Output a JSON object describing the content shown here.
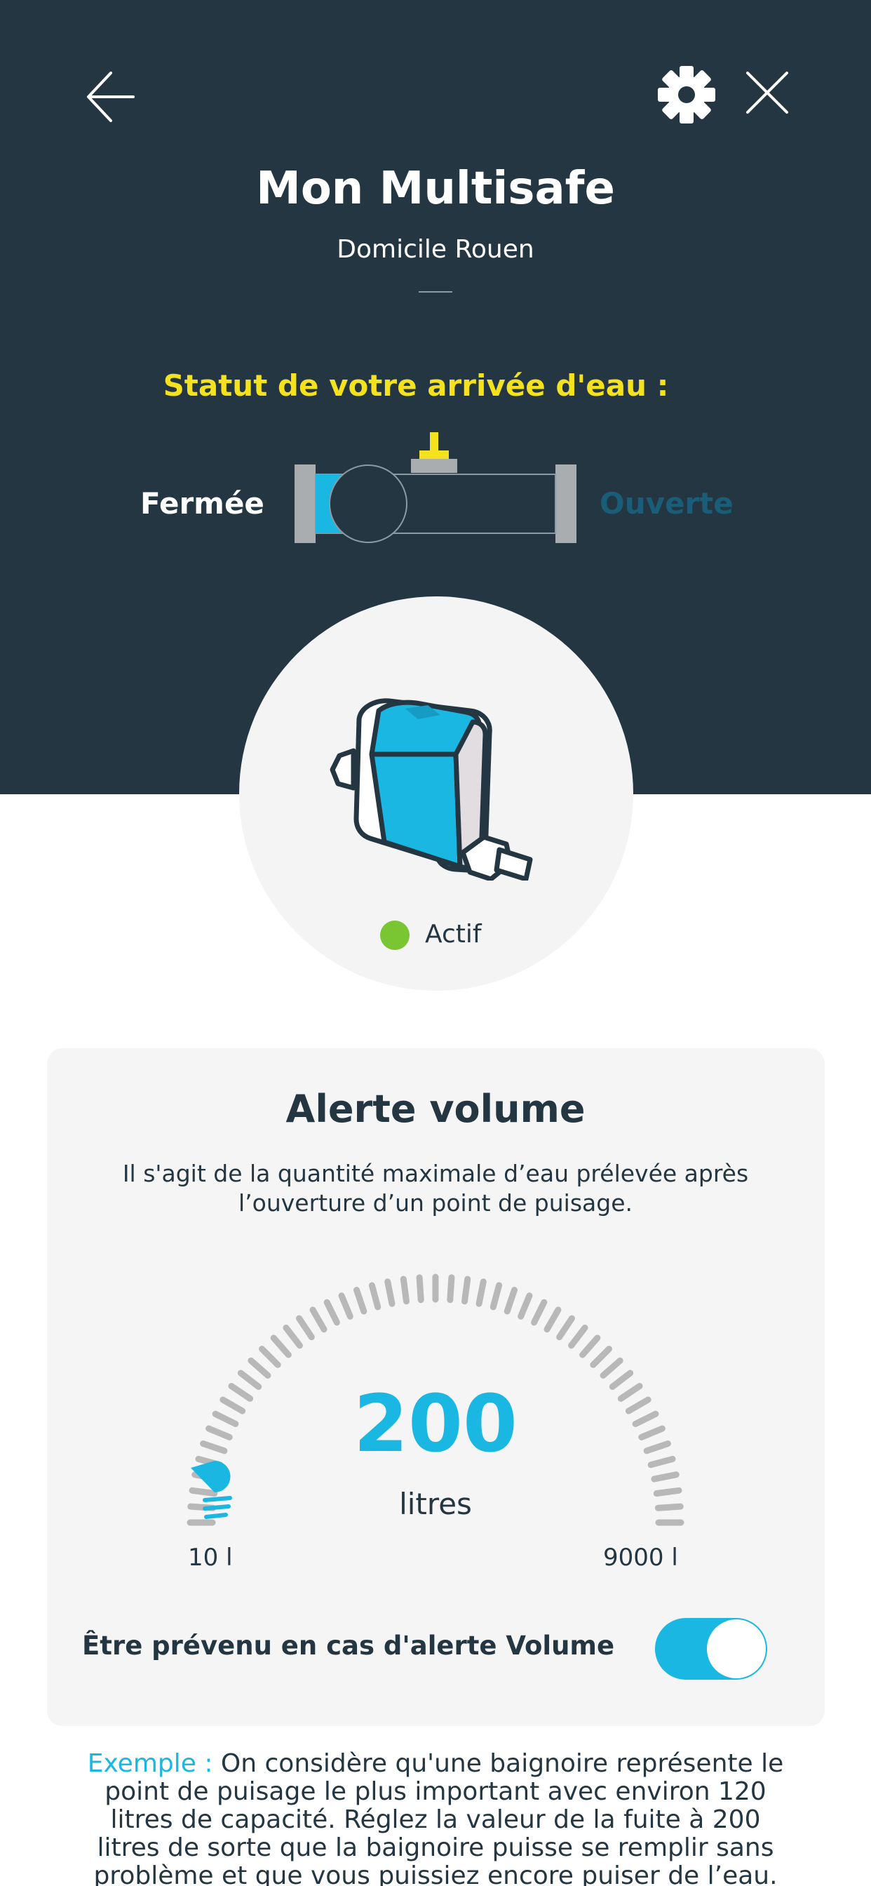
{
  "header": {
    "title": "Mon Multisafe",
    "subtitle": "Domicile Rouen",
    "icons": {
      "back": "arrow-left-icon",
      "settings": "gear-icon",
      "close": "close-icon"
    }
  },
  "water_status": {
    "heading": "Statut de votre arrivée d'eau :",
    "closed_label": "Fermée",
    "open_label": "Ouverte",
    "current": "Fermée"
  },
  "device": {
    "status_text": "Actif",
    "status_color": "#7ac532"
  },
  "volume_alert": {
    "title": "Alerte volume",
    "description": "Il s'agit de la quantité maximale d’eau prélevée après l’ouverture d’un point de puisage.",
    "value": "200",
    "unit": "litres",
    "min_label": "10 l",
    "max_label": "9000 l",
    "toggle_label": "Être prévenu en cas d'alerte Volume",
    "toggle_on": true
  },
  "example": {
    "label": "Exemple :",
    "text": " On considère qu'une baignoire représente le point de puisage le plus important avec environ 120 litres de capacité. Réglez la valeur de la fuite à 200 litres de sorte que la baignoire puisse se remplir sans problème et que vous puissiez encore puiser de l’eau."
  },
  "colors": {
    "header_bg": "#233642",
    "accent": "#1ab7e3",
    "status_yellow": "#f3e21d",
    "open_label": "#1a5d79",
    "card_bg": "#f5f5f5"
  }
}
